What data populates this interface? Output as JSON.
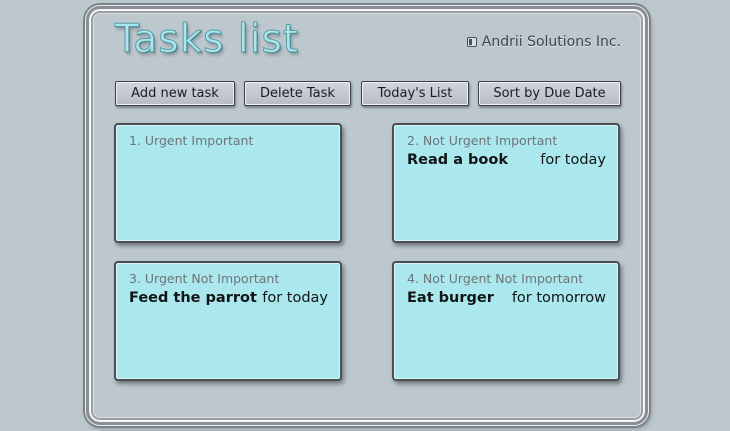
{
  "app": {
    "title": "Tasks list",
    "company": "Andrii Solutions Inc.",
    "company_icon": "copyright-icon"
  },
  "toolbar": {
    "add_label": "Add new task",
    "delete_label": "Delete Task",
    "today_label": "Today's List",
    "sort_label": "Sort by Due Date"
  },
  "quadrants": [
    {
      "header": "1. Urgent Important",
      "tasks": []
    },
    {
      "header": "2. Not Urgent Important",
      "tasks": [
        {
          "name": "Read a book",
          "due": "for today"
        }
      ]
    },
    {
      "header": "3. Urgent Not Important",
      "tasks": [
        {
          "name": "Feed the parrot",
          "due": "for today"
        }
      ]
    },
    {
      "header": "4. Not Urgent Not Important",
      "tasks": [
        {
          "name": "Eat burger",
          "due": "for tomorrow"
        }
      ]
    }
  ],
  "colors": {
    "background": "#bcc7ce",
    "quadrant": "#aae8ee",
    "title": "#a8e8ee",
    "button": "#c6c8d2"
  }
}
